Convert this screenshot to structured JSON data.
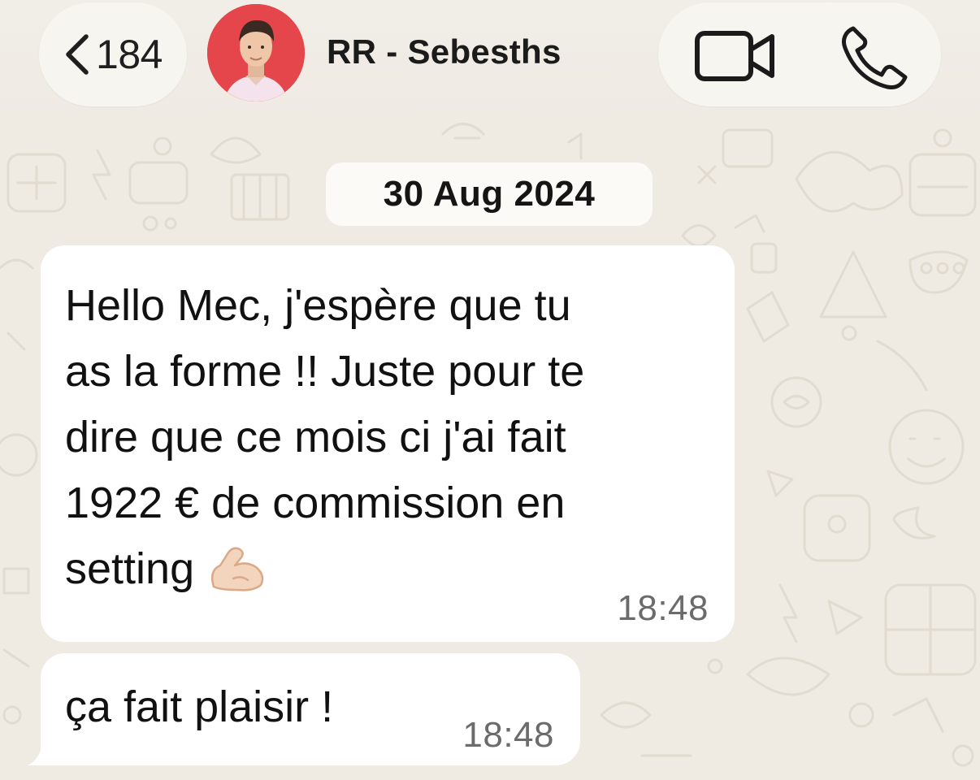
{
  "header": {
    "back_count": "184",
    "contact_name": "RR - Sebesths",
    "video_icon": "video-camera-icon",
    "phone_icon": "phone-icon",
    "back_icon": "chevron-left-icon"
  },
  "chat": {
    "date_separator": "30 Aug 2024",
    "messages": [
      {
        "text": "Hello Mec, j'espère que tu\nas la forme !! Juste pour te\ndire que ce mois ci j'ai fait\n1922 € de commission en\nsetting",
        "emoji": "flexed-biceps-icon",
        "time": "18:48"
      },
      {
        "text": "ça fait plaisir !",
        "time": "18:48"
      }
    ]
  },
  "colors": {
    "background": "#efeae2",
    "bubble": "#ffffff",
    "avatar_bg": "#e4464b",
    "time_text": "#6b6b6b"
  }
}
